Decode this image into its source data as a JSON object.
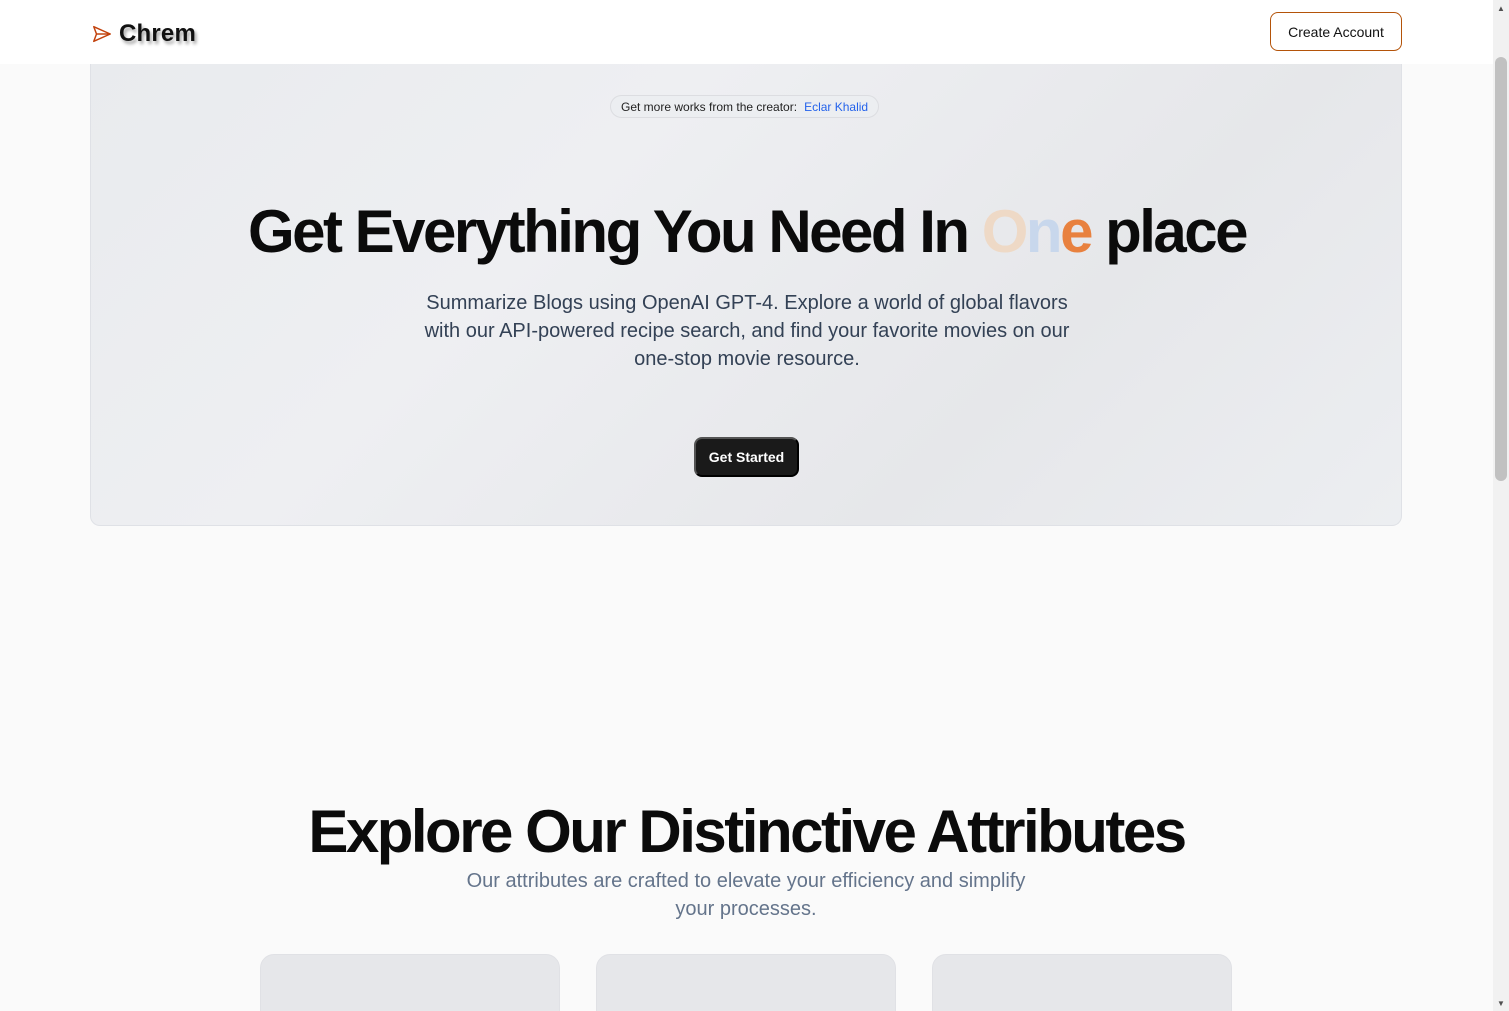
{
  "header": {
    "brand": "Chrem",
    "create_account_label": "Create Account",
    "brand_color": "#c2410c"
  },
  "hero": {
    "creator_prefix": "Get more works from the creator:",
    "creator_name": "Eclar Khalid",
    "title_before": "Get Everything You Need In ",
    "title_gradient_1": "O",
    "title_gradient_2": "n",
    "title_gradient_3": "e",
    "title_after": " place",
    "subtitle": "Summarize Blogs using OpenAI GPT-4. Explore a world of global flavors with our API-powered recipe search, and find your favorite movies on our one-stop movie resource.",
    "cta_label": "Get Started"
  },
  "attributes": {
    "title": "Explore Our Distinctive Attributes",
    "subtitle": "Our attributes are crafted to elevate your efficiency and simplify your processes.",
    "cards": [
      {},
      {},
      {}
    ]
  },
  "colors": {
    "accent": "#b45309",
    "link": "#2563eb",
    "cta_bg": "#1a1a1a"
  },
  "icons": {
    "logo": "paper-plane-icon",
    "scroll_up": "triangle-up-icon",
    "scroll_down": "triangle-down-icon"
  }
}
